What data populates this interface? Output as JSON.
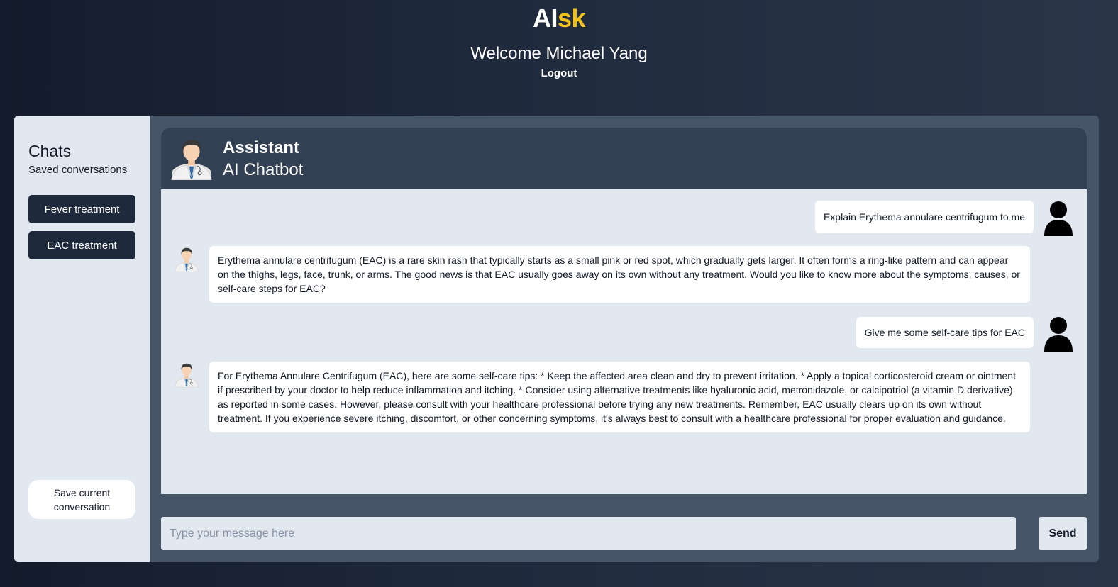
{
  "header": {
    "logo_main": "AI",
    "logo_accent": "sk",
    "welcome": "Welcome Michael Yang",
    "logout_label": "Logout"
  },
  "sidebar": {
    "title": "Chats",
    "subtitle": "Saved conversations",
    "chats": [
      {
        "label": "Fever treatment"
      },
      {
        "label": "EAC treatment"
      }
    ],
    "save_label": "Save current conversation"
  },
  "chat": {
    "assistant_name": "Assistant",
    "assistant_role": "AI Chatbot",
    "messages": [
      {
        "role": "user",
        "text": "Explain Erythema annulare centrifugum to me"
      },
      {
        "role": "assistant",
        "text": "Erythema annulare centrifugum (EAC) is a rare skin rash that typically starts as a small pink or red spot, which gradually gets larger. It often forms a ring-like pattern and can appear on the thighs, legs, face, trunk, or arms. The good news is that EAC usually goes away on its own without any treatment. Would you like to know more about the symptoms, causes, or self-care steps for EAC?"
      },
      {
        "role": "user",
        "text": "Give me some self-care tips for EAC"
      },
      {
        "role": "assistant",
        "text": "For Erythema Annulare Centrifugum (EAC), here are some self-care tips: * Keep the affected area clean and dry to prevent irritation. * Apply a topical corticosteroid cream or ointment if prescribed by your doctor to help reduce inflammation and itching. * Consider using alternative treatments like hyaluronic acid, metronidazole, or calcipotriol (a vitamin D derivative) as reported in some cases. However, please consult with your healthcare professional before trying any new treatments. Remember, EAC usually clears up on its own without treatment. If you experience severe itching, discomfort, or other concerning symptoms, it's always best to consult with a healthcare professional for proper evaluation and guidance."
      }
    ]
  },
  "composer": {
    "placeholder": "Type your message here",
    "value": "",
    "send_label": "Send"
  },
  "colors": {
    "accent": "#f2c21a",
    "sidebar_button": "#1e293b",
    "chat_header": "#334155",
    "panel_bg": "#e2e8f0"
  }
}
